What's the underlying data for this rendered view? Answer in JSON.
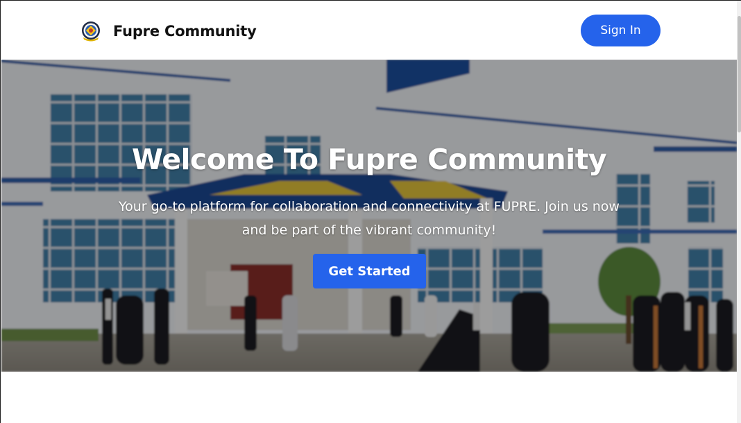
{
  "header": {
    "brand_name": "Fupre Community",
    "logo_icon": "university-crest-icon",
    "signin_label": "Sign In"
  },
  "hero": {
    "title": "Welcome To Fupre Community",
    "subtitle": "Your go-to platform for collaboration and connectivity at FUPRE. Join us now and be part of the vibrant community!",
    "cta_label": "Get Started",
    "background": "campus-building-photo"
  },
  "colors": {
    "accent": "#2563eb",
    "header_bg": "#ffffff",
    "hero_text": "#ffffff"
  }
}
